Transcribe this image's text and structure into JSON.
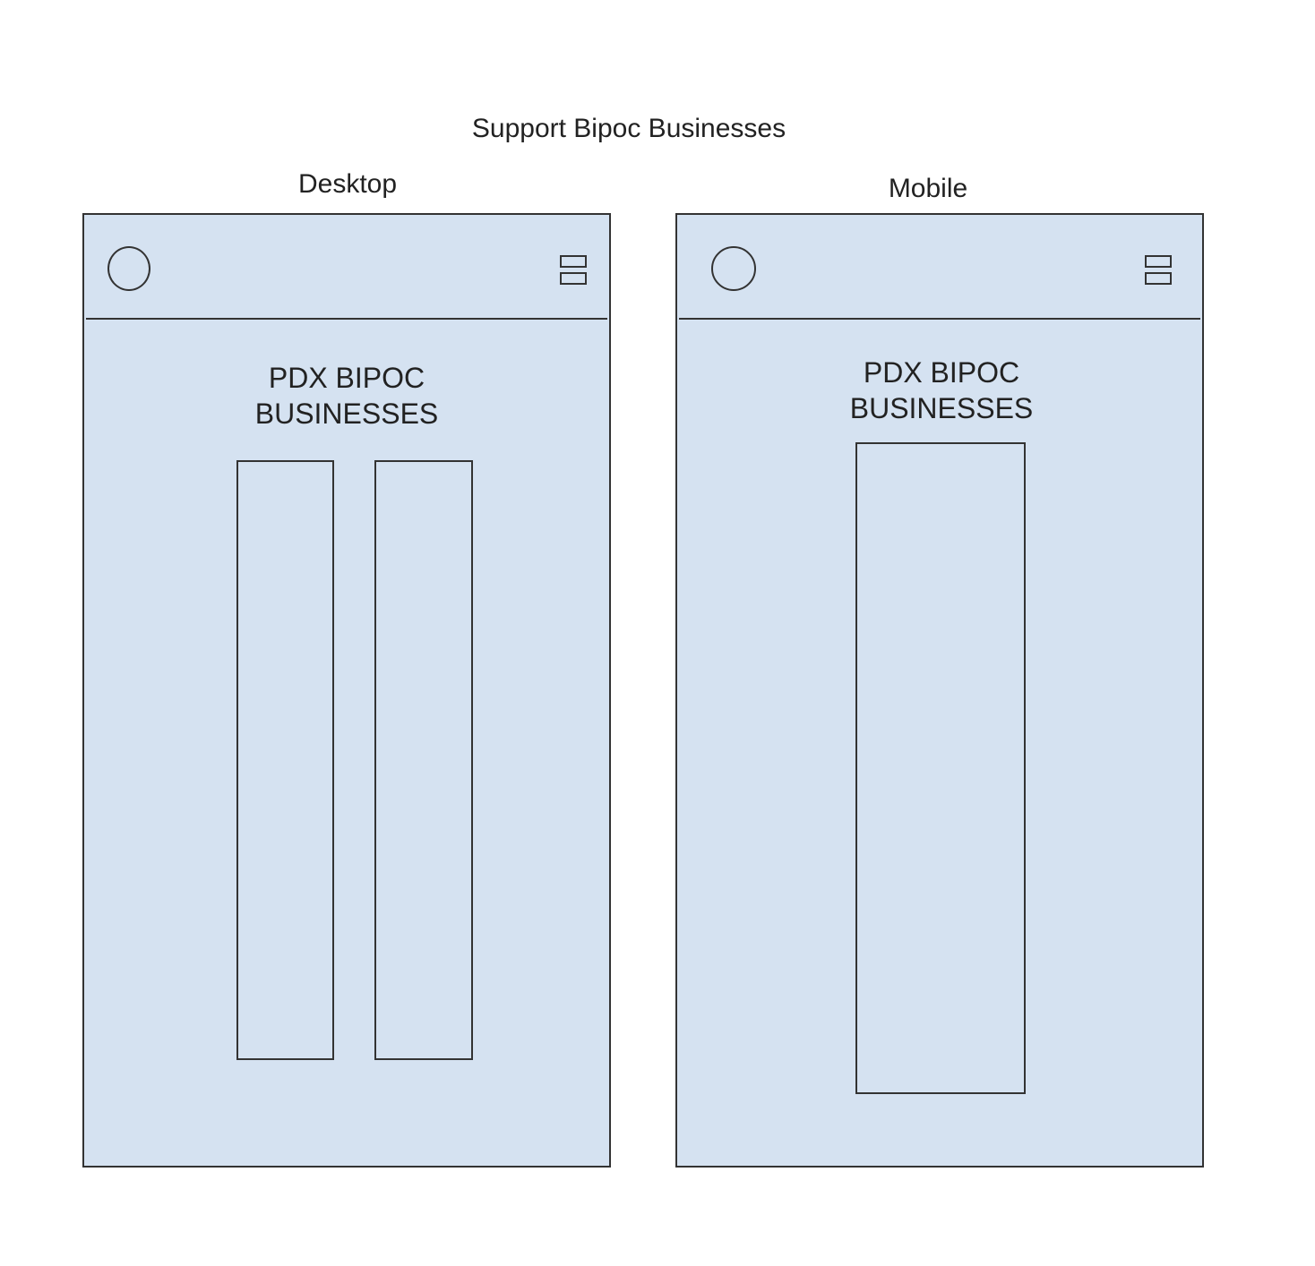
{
  "title": "Support Bipoc Businesses",
  "desktop": {
    "label": "Desktop",
    "header": {
      "logo_icon": "circle-logo-icon",
      "menu_icon": "hamburger-menu-icon"
    },
    "heading_line1": "PDX BIPOC",
    "heading_line2": "BUSINESSES"
  },
  "mobile": {
    "label": "Mobile",
    "header": {
      "logo_icon": "circle-logo-icon",
      "menu_icon": "hamburger-menu-icon"
    },
    "heading_line1": "PDX BIPOC",
    "heading_line2": "BUSINESSES"
  },
  "colors": {
    "frame_fill": "#d5e2f1",
    "stroke": "#333333"
  }
}
